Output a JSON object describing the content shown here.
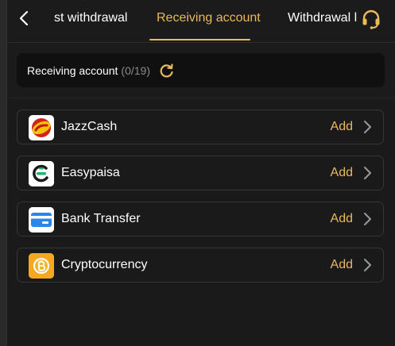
{
  "header": {
    "tabs": [
      {
        "label": "st withdrawal",
        "active": false
      },
      {
        "label": "Receiving account",
        "active": true
      },
      {
        "label": "Withdrawal l",
        "active": false
      }
    ]
  },
  "account_bar": {
    "title": "Receiving account",
    "count": "(0/19)"
  },
  "methods": [
    {
      "name": "JazzCash",
      "action": "Add",
      "icon": "jazzcash-logo"
    },
    {
      "name": "Easypaisa",
      "action": "Add",
      "icon": "easypaisa-logo"
    },
    {
      "name": "Bank Transfer",
      "action": "Add",
      "icon": "bank-card-icon"
    },
    {
      "name": "Cryptocurrency",
      "action": "Add",
      "icon": "bitcoin-icon"
    }
  ],
  "colors": {
    "accent": "#e9b95a",
    "background": "#1b1b1b",
    "row_border": "#363636"
  }
}
